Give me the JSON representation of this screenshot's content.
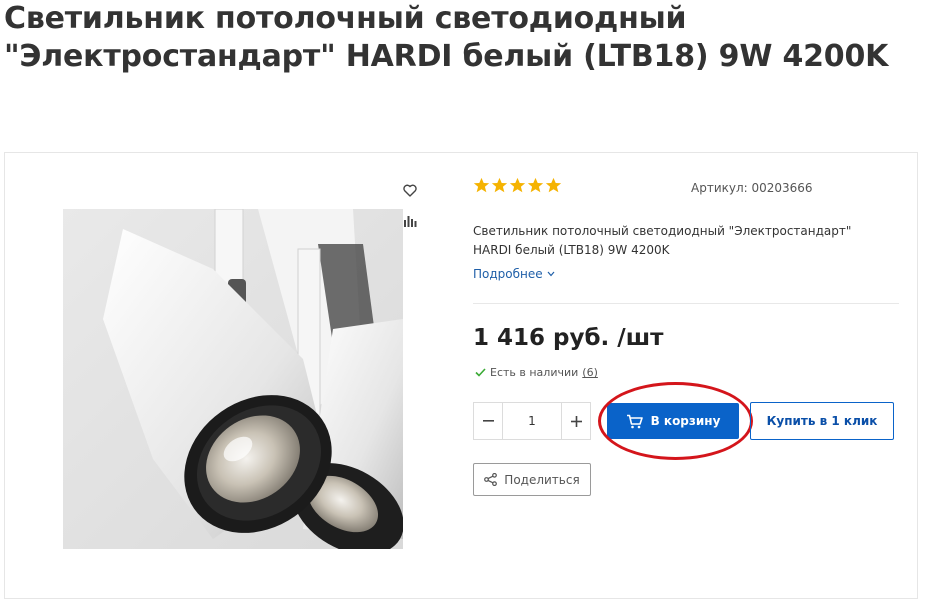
{
  "product": {
    "title": "Светильник потолочный светодиодный \"Электростандарт\" HARDI белый (LTB18) 9W 4200K",
    "sku": "Артикул: 00203666",
    "rating": 5,
    "description": "Светильник потолочный светодиодный \"Электростандарт\" HARDI белый (LTB18) 9W 4200K",
    "more_label": "Подробнее",
    "price": "1 416 руб. /шт",
    "stock_label": "Есть в наличии",
    "stock_count": "(6)",
    "quantity": "1"
  },
  "actions": {
    "cart_label": "В корзину",
    "one_click_label": "Купить в 1 клик",
    "share_label": "Поделиться"
  },
  "colors": {
    "accent": "#0a63c9",
    "highlight": "#d4151b",
    "star": "#f5b301",
    "in_stock": "#3aaa35"
  },
  "icons": [
    "heart-icon",
    "compare-icon",
    "star-icon",
    "chevron-down-icon",
    "check-icon",
    "minus-icon",
    "plus-icon",
    "cart-icon",
    "share-icon"
  ]
}
